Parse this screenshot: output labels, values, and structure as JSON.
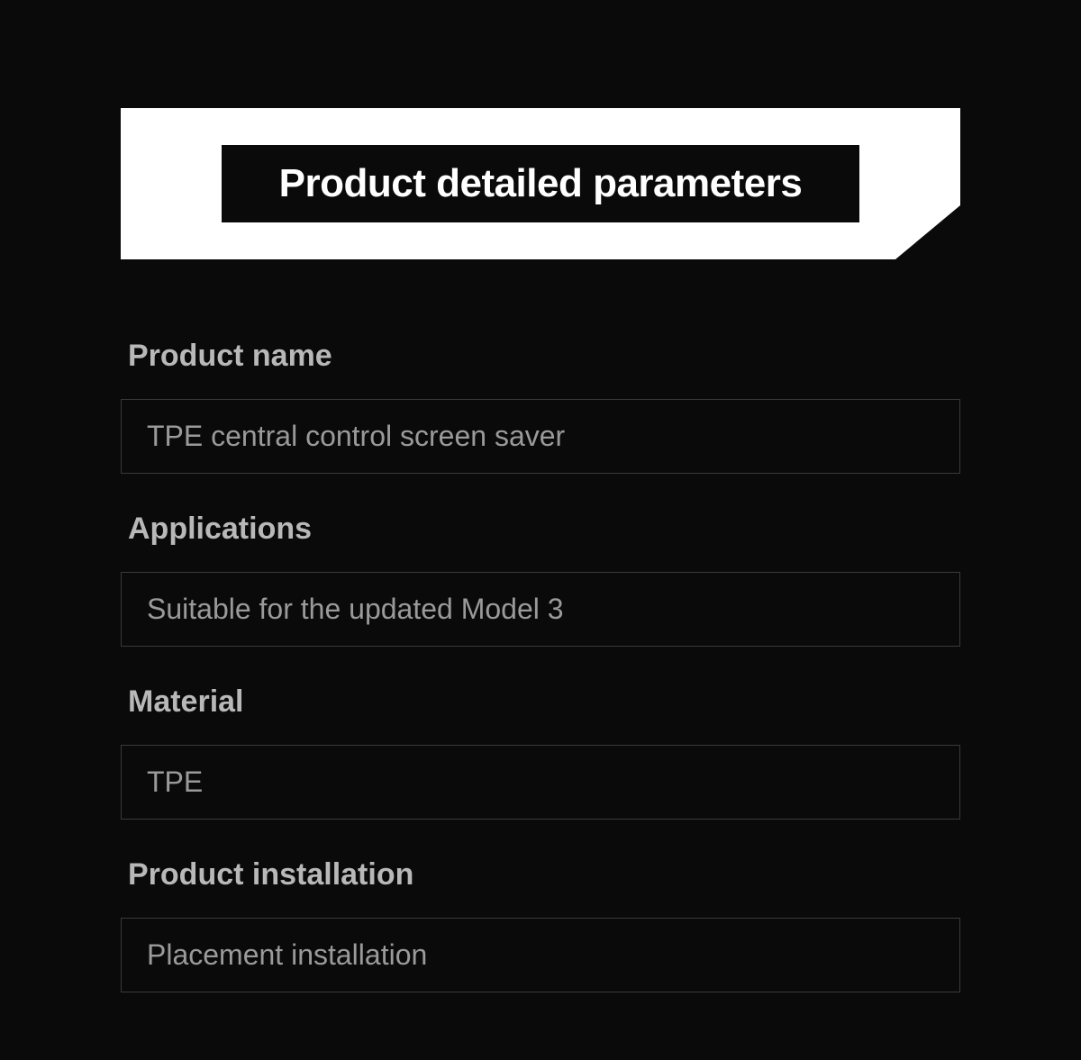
{
  "header": {
    "title": "Product detailed parameters"
  },
  "parameters": [
    {
      "label": "Product name",
      "value": "TPE central control screen saver"
    },
    {
      "label": "Applications",
      "value": "Suitable for the updated Model 3"
    },
    {
      "label": "Material",
      "value": "TPE"
    },
    {
      "label": "Product installation",
      "value": "Placement installation"
    }
  ]
}
